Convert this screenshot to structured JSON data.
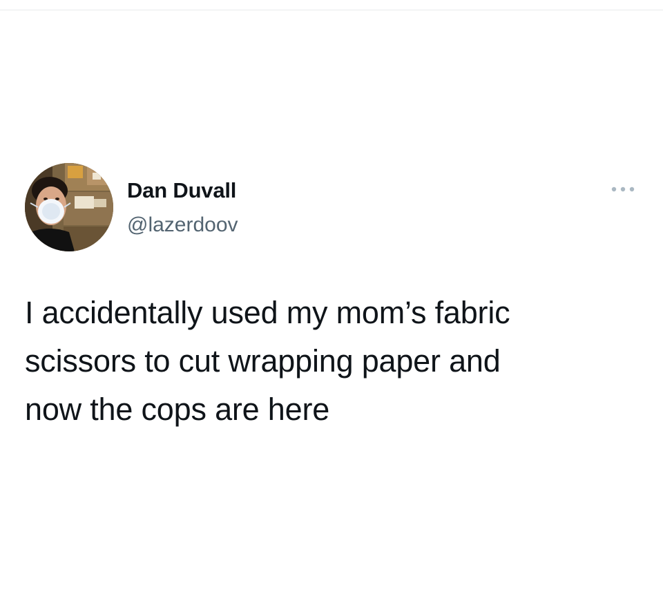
{
  "tweet": {
    "author": {
      "display_name": "Dan Duvall",
      "handle": "@lazerdoov",
      "avatar_icon": "profile-photo"
    },
    "text": "I accidentally used my mom’s fabric\nscissors to cut wrapping paper and\nnow the cops are here",
    "more_icon": "more-options-icon"
  },
  "colors": {
    "text_primary": "#0f1419",
    "text_secondary": "#536471",
    "background": "#ffffff",
    "divider": "#e8eaec",
    "more_icon": "#aab8c2"
  }
}
